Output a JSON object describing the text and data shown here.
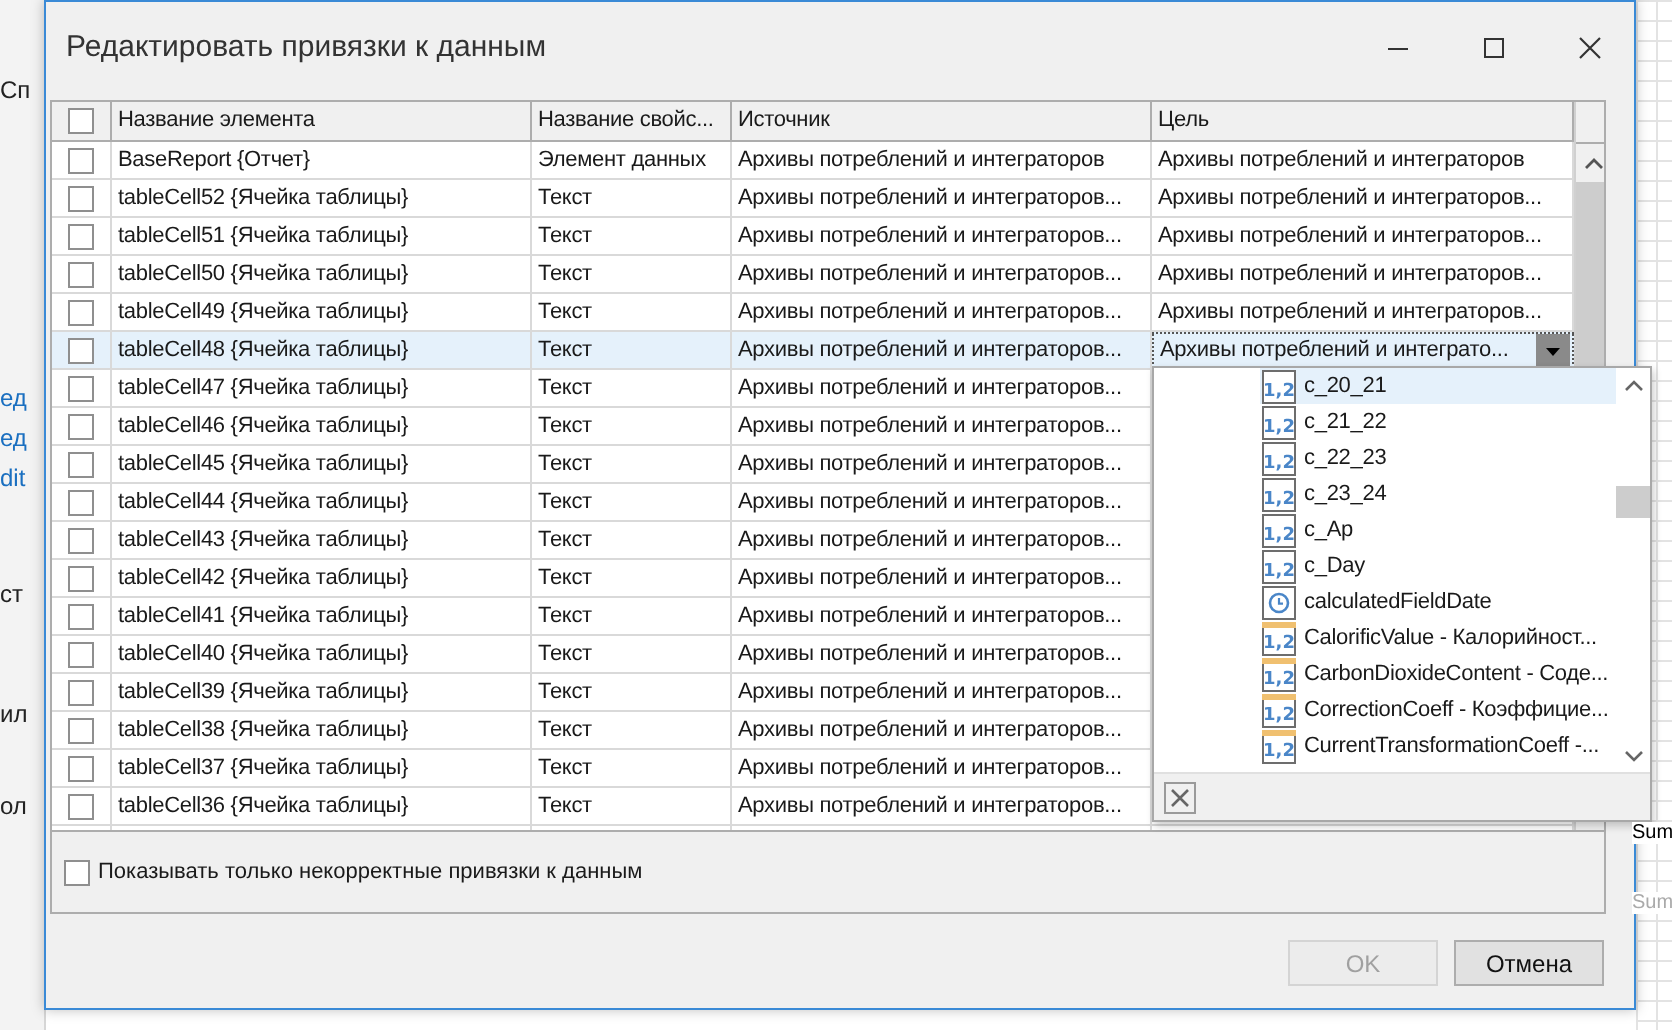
{
  "background_app": {
    "left_texts": [
      "Сп",
      "ед",
      "ед",
      "dit",
      "ст",
      "ил",
      "ол"
    ],
    "right_texts": [
      "Sum",
      "Sum"
    ]
  },
  "window": {
    "title": "Редактировать привязки к данным"
  },
  "table": {
    "header_checked": false,
    "columns": [
      "Название элемента",
      "Название свойс...",
      "Источник",
      "Цель"
    ],
    "rows": [
      {
        "checked": false,
        "selected": false,
        "name": "BaseReport {Отчет}",
        "property": "Элемент данных",
        "source": "Архивы потреблений и интеграторов",
        "target": "Архивы потреблений и интеграторов"
      },
      {
        "checked": false,
        "selected": false,
        "name": "tableCell52 {Ячейка таблицы}",
        "property": "Текст",
        "source": "Архивы потреблений и интеграторов...",
        "target": "Архивы потреблений и интеграторов..."
      },
      {
        "checked": false,
        "selected": false,
        "name": "tableCell51 {Ячейка таблицы}",
        "property": "Текст",
        "source": "Архивы потреблений и интеграторов...",
        "target": "Архивы потреблений и интеграторов..."
      },
      {
        "checked": false,
        "selected": false,
        "name": "tableCell50 {Ячейка таблицы}",
        "property": "Текст",
        "source": "Архивы потреблений и интеграторов...",
        "target": "Архивы потреблений и интеграторов..."
      },
      {
        "checked": false,
        "selected": false,
        "name": "tableCell49 {Ячейка таблицы}",
        "property": "Текст",
        "source": "Архивы потреблений и интеграторов...",
        "target": "Архивы потреблений и интеграторов..."
      },
      {
        "checked": false,
        "selected": true,
        "name": "tableCell48 {Ячейка таблицы}",
        "property": "Текст",
        "source": "Архивы потреблений и интеграторов...",
        "target": "Архивы потреблений и интеграто...",
        "editing": true
      },
      {
        "checked": false,
        "selected": false,
        "name": "tableCell47 {Ячейка таблицы}",
        "property": "Текст",
        "source": "Архивы потреблений и интеграторов..."
      },
      {
        "checked": false,
        "selected": false,
        "name": "tableCell46 {Ячейка таблицы}",
        "property": "Текст",
        "source": "Архивы потреблений и интеграторов..."
      },
      {
        "checked": false,
        "selected": false,
        "name": "tableCell45 {Ячейка таблицы}",
        "property": "Текст",
        "source": "Архивы потреблений и интеграторов..."
      },
      {
        "checked": false,
        "selected": false,
        "name": "tableCell44 {Ячейка таблицы}",
        "property": "Текст",
        "source": "Архивы потреблений и интеграторов..."
      },
      {
        "checked": false,
        "selected": false,
        "name": "tableCell43 {Ячейка таблицы}",
        "property": "Текст",
        "source": "Архивы потреблений и интеграторов..."
      },
      {
        "checked": false,
        "selected": false,
        "name": "tableCell42 {Ячейка таблицы}",
        "property": "Текст",
        "source": "Архивы потреблений и интеграторов..."
      },
      {
        "checked": false,
        "selected": false,
        "name": "tableCell41 {Ячейка таблицы}",
        "property": "Текст",
        "source": "Архивы потреблений и интеграторов..."
      },
      {
        "checked": false,
        "selected": false,
        "name": "tableCell40 {Ячейка таблицы}",
        "property": "Текст",
        "source": "Архивы потреблений и интеграторов..."
      },
      {
        "checked": false,
        "selected": false,
        "name": "tableCell39 {Ячейка таблицы}",
        "property": "Текст",
        "source": "Архивы потреблений и интеграторов..."
      },
      {
        "checked": false,
        "selected": false,
        "name": "tableCell38 {Ячейка таблицы}",
        "property": "Текст",
        "source": "Архивы потреблений и интеграторов..."
      },
      {
        "checked": false,
        "selected": false,
        "name": "tableCell37 {Ячейка таблицы}",
        "property": "Текст",
        "source": "Архивы потреблений и интеграторов..."
      },
      {
        "checked": false,
        "selected": false,
        "name": "tableCell36 {Ячейка таблицы}",
        "property": "Текст",
        "source": "Архивы потреблений и интеграторов..."
      }
    ]
  },
  "dropdown": {
    "items": [
      {
        "kind": "number",
        "icon_text": "1,2",
        "label": "c_20_21",
        "selected": true
      },
      {
        "kind": "number",
        "icon_text": "1,2",
        "label": "c_21_22",
        "selected": false
      },
      {
        "kind": "number",
        "icon_text": "1,2",
        "label": "c_22_23",
        "selected": false
      },
      {
        "kind": "number",
        "icon_text": "1,2",
        "label": "c_23_24",
        "selected": false
      },
      {
        "kind": "number",
        "icon_text": "1,2",
        "label": "c_Ap",
        "selected": false
      },
      {
        "kind": "number",
        "icon_text": "1,2",
        "label": "c_Day",
        "selected": false
      },
      {
        "kind": "date",
        "label": "calculatedFieldDate",
        "selected": false
      },
      {
        "kind": "parameter",
        "icon_text": "1,2",
        "label": "CalorificValue - Калорийност...",
        "selected": false
      },
      {
        "kind": "parameter",
        "icon_text": "1,2",
        "label": "CarbonDioxideContent - Соде...",
        "selected": false
      },
      {
        "kind": "parameter",
        "icon_text": "1,2",
        "label": "CorrectionCoeff - Коэффицие...",
        "selected": false
      },
      {
        "kind": "parameter",
        "icon_text": "1,2",
        "label": "CurrentTransformationCoeff -...",
        "selected": false
      }
    ]
  },
  "filter": {
    "label": "Показывать только некорректные привязки к данным",
    "checked": false
  },
  "buttons": [
    {
      "label": "OK",
      "disabled": true
    },
    {
      "label": "Отмена",
      "disabled": false
    }
  ]
}
